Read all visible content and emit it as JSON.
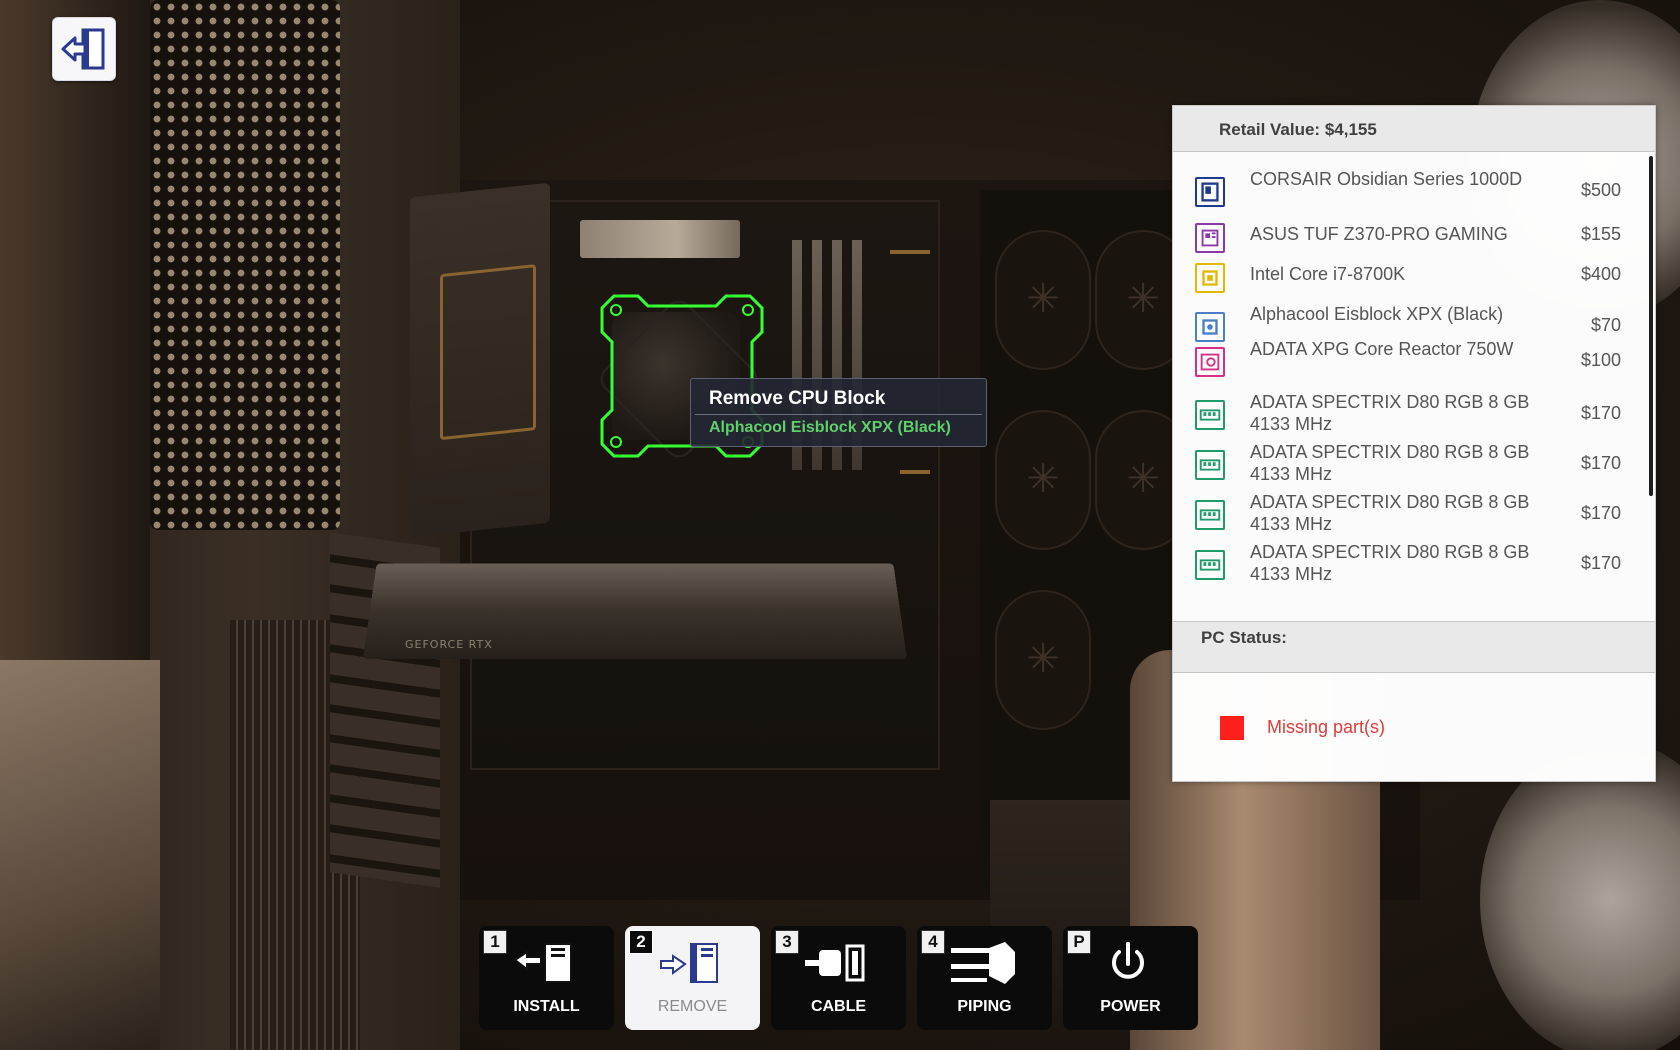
{
  "tooltip": {
    "title": "Remove CPU Block",
    "subtitle": "Alphacool Eisblock XPX (Black)"
  },
  "scene": {
    "gpu_label": "GEFORCE RTX"
  },
  "panel": {
    "retail_value": "Retail Value: $4,155",
    "parts": [
      {
        "icon": "case-icon",
        "color": "#1f3a8a",
        "name": "CORSAIR Obsidian Series 1000D",
        "price": "$500"
      },
      {
        "icon": "motherboard-icon",
        "color": "#8a3aa8",
        "name": "ASUS TUF Z370-PRO GAMING",
        "price": "$155"
      },
      {
        "icon": "cpu-icon",
        "color": "#e3b800",
        "name": "Intel Core i7-8700K",
        "price": "$400"
      },
      {
        "icon": "cpu-cooler-icon",
        "color": "#4a7fc8",
        "name": "Alphacool Eisblock XPX (Black)",
        "price": "$70"
      },
      {
        "icon": "psu-icon",
        "color": "#d62f8a",
        "name": "ADATA XPG Core Reactor 750W",
        "price": "$100"
      },
      {
        "icon": "ram-icon",
        "color": "#1f9a6a",
        "name": "ADATA SPECTRIX D80 RGB 8 GB 4133 MHz",
        "price": "$170"
      },
      {
        "icon": "ram-icon",
        "color": "#1f9a6a",
        "name": "ADATA SPECTRIX D80 RGB 8 GB 4133 MHz",
        "price": "$170"
      },
      {
        "icon": "ram-icon",
        "color": "#1f9a6a",
        "name": "ADATA SPECTRIX D80 RGB 8 GB 4133 MHz",
        "price": "$170"
      },
      {
        "icon": "ram-icon",
        "color": "#1f9a6a",
        "name": "ADATA SPECTRIX D80 RGB 8 GB 4133 MHz",
        "price": "$170"
      }
    ],
    "status_label": "PC Status:",
    "status_text": "Missing part(s)",
    "status_color": "#ff1e1e"
  },
  "toolbar": {
    "tools": [
      {
        "key": "1",
        "label": "INSTALL",
        "icon": "install-icon",
        "active": false
      },
      {
        "key": "2",
        "label": "REMOVE",
        "icon": "remove-icon",
        "active": true
      },
      {
        "key": "3",
        "label": "CABLE",
        "icon": "cable-icon",
        "active": false
      },
      {
        "key": "4",
        "label": "PIPING",
        "icon": "piping-icon",
        "active": false
      },
      {
        "key": "P",
        "label": "POWER",
        "icon": "power-icon",
        "active": false
      }
    ]
  },
  "exit_button": {
    "icon": "exit-icon"
  }
}
